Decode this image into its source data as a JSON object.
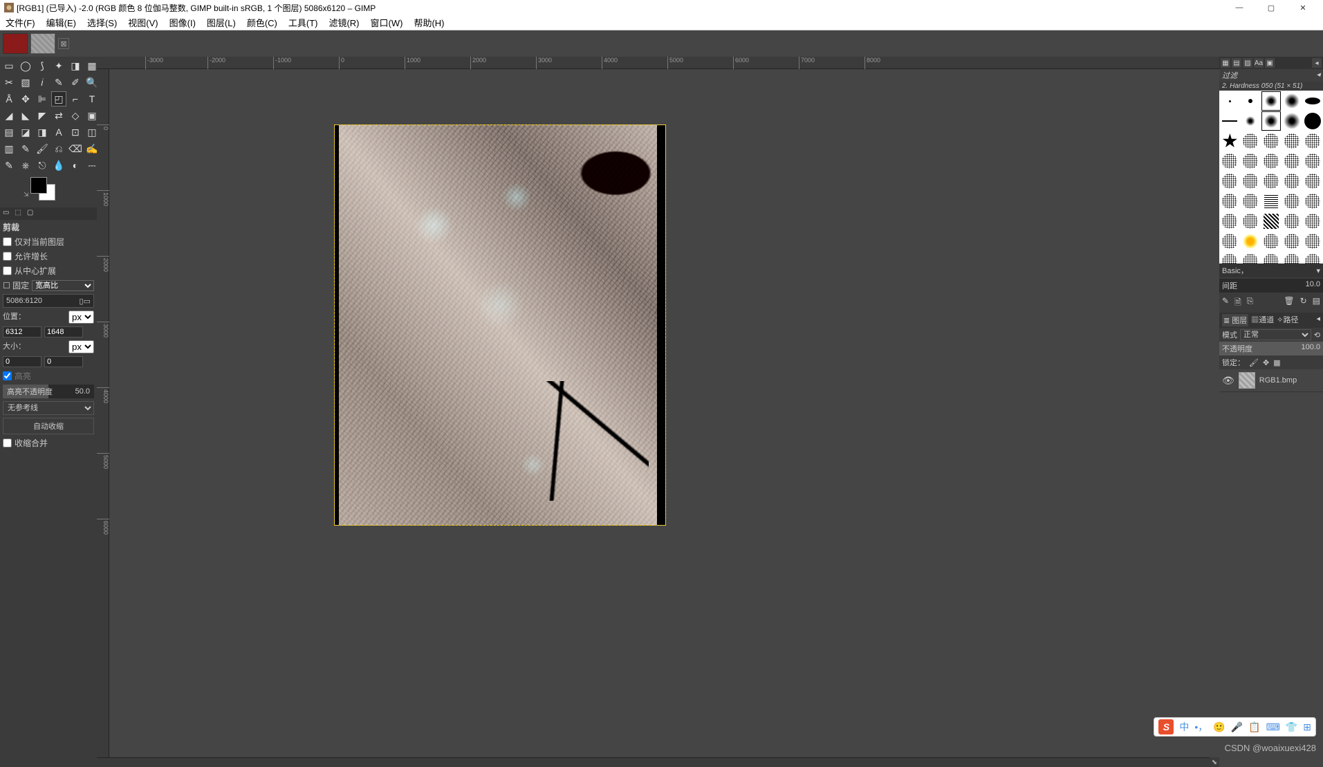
{
  "title": "[RGB1] (已导入) -2.0 (RGB 颜色 8 位伽马整数, GIMP built-in sRGB, 1 个图层) 5086x6120 – GIMP",
  "menu": [
    "文件(F)",
    "编辑(E)",
    "选择(S)",
    "视图(V)",
    "图像(I)",
    "图层(L)",
    "颜色(C)",
    "工具(T)",
    "滤镜(R)",
    "窗口(W)",
    "帮助(H)"
  ],
  "options": {
    "tabs": [
      "□",
      "⬚",
      "▢"
    ],
    "title": "剪裁",
    "only_current_layer": "仅对当前图层",
    "allow_grow": "允许增长",
    "from_center": "从中心扩展",
    "fixed_label": "固定",
    "aspect_label": "宽高比",
    "aspect_value": "5086:6120",
    "position_label": "位置：",
    "pos_x": "6312",
    "pos_y": "1648",
    "unit_px": "px",
    "size_label": "大小：",
    "size_x": "0",
    "size_y": "0",
    "highlight_label": "高亮",
    "highlight_opacity_label": "高亮不透明度",
    "highlight_opacity_value": "50.0",
    "guides_label": "无参考线",
    "autoshrink": "自动收缩",
    "shrink_merged": "收缩合并"
  },
  "ruler_h": [
    "-3000",
    "-2000",
    "-1000",
    "0",
    "1000",
    "2000",
    "3000",
    "4000",
    "5000",
    "6000",
    "7000",
    "8000"
  ],
  "ruler_v": [
    "0",
    "1000",
    "2000",
    "3000",
    "4000",
    "5000",
    "6000"
  ],
  "brushes": {
    "section": "过滤",
    "info": "2. Hardness 050 (51 × 51)",
    "preset": "Basic，",
    "spacing_label": "间距",
    "spacing_value": "10.0"
  },
  "layers": {
    "tab_layers": "图层",
    "tab_channels": "通道",
    "tab_paths": "路径",
    "mode_label": "模式",
    "mode_value": "正常",
    "opacity_label": "不透明度",
    "opacity_value": "100.0",
    "lock_label": "锁定：",
    "layer_name": "RGB1.bmp"
  },
  "ime": {
    "lang": "中",
    "items": [
      "🙂",
      "🎤",
      "📋",
      "⌨",
      "👕",
      "⊞"
    ]
  },
  "watermark": "CSDN @woaixuexi428"
}
